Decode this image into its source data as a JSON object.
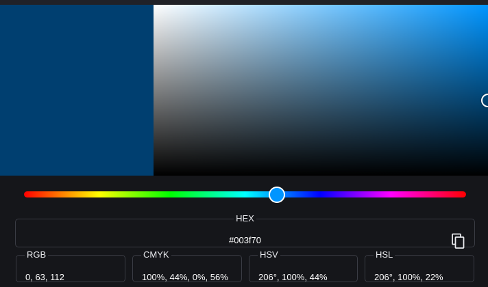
{
  "colors": {
    "current": "#003f70",
    "hue_pure": "#0095ff",
    "hue_thumb": "#0095ff",
    "page_background": "#15161a"
  },
  "picker": {
    "hue_degrees": 206,
    "saturation_percent": 100,
    "value_percent": 44,
    "hue_fraction": 0.572
  },
  "hex": {
    "label": "HEX",
    "value": "#003f70",
    "copy_icon": "copy-icon"
  },
  "formats": [
    {
      "label": "RGB",
      "value": "0, 63, 112"
    },
    {
      "label": "CMYK",
      "value": "100%, 44%, 0%, 56%"
    },
    {
      "label": "HSV",
      "value": "206°, 100%, 44%"
    },
    {
      "label": "HSL",
      "value": "206°, 100%, 22%"
    }
  ]
}
